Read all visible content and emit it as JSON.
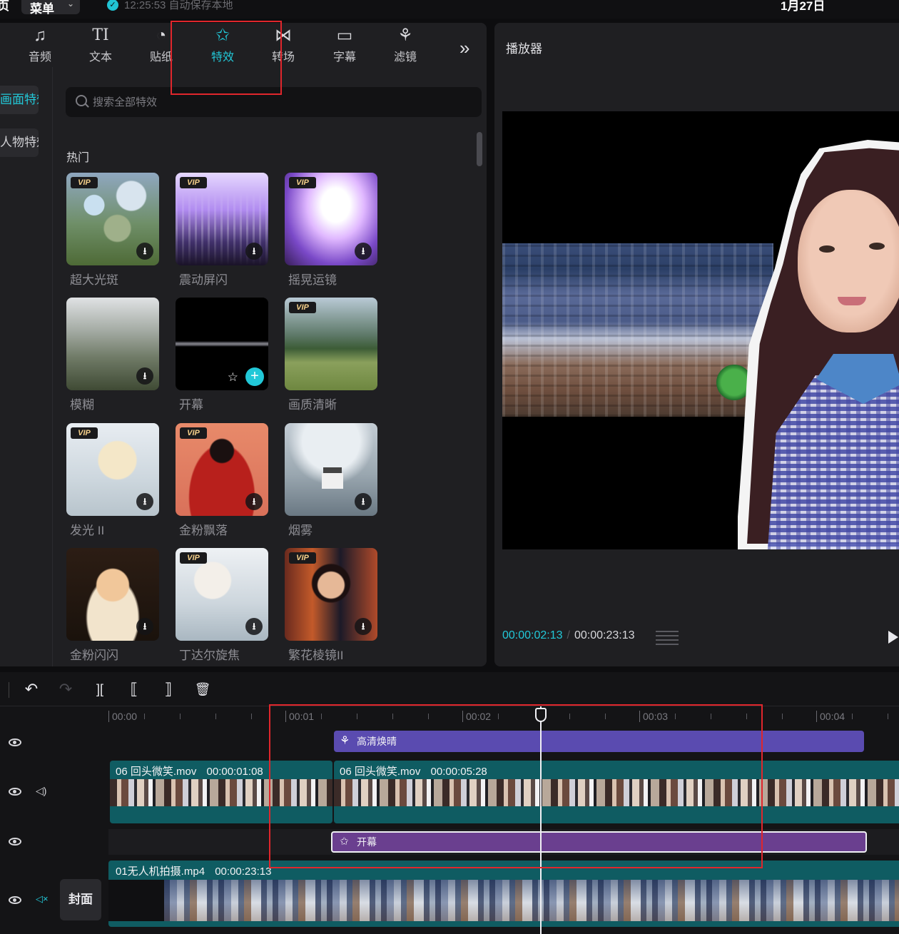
{
  "topbar": {
    "left_cut": "页",
    "menu_label": "菜单",
    "autosave_text": "12:25:53 自动保存本地",
    "date_text": "1月27日"
  },
  "tabs": [
    {
      "label": "音频",
      "icon": "music-note-icon"
    },
    {
      "label": "文本",
      "icon": "text-icon"
    },
    {
      "label": "贴纸",
      "icon": "sticker-icon"
    },
    {
      "label": "特效",
      "icon": "sparkle-star-icon",
      "active": true
    },
    {
      "label": "转场",
      "icon": "bowtie-transition-icon"
    },
    {
      "label": "字幕",
      "icon": "subtitle-icon"
    },
    {
      "label": "滤镜",
      "icon": "filter-circles-icon"
    }
  ],
  "tab_icons": {
    "audio": "♫",
    "text": "TI",
    "sticker": "◔",
    "effect": "✩",
    "transition": "⋈",
    "subtitle": "▭",
    "filter": "⚘",
    "more": "»"
  },
  "categories": [
    {
      "label": "画面特效",
      "active": true
    },
    {
      "label": "人物特效",
      "active": false
    }
  ],
  "search": {
    "placeholder": "搜索全部特效"
  },
  "section_title": "热门",
  "effects": [
    {
      "name": "超大光斑",
      "vip": true,
      "action": "download"
    },
    {
      "name": "震动屏闪",
      "vip": true,
      "action": "download"
    },
    {
      "name": "摇晃运镜",
      "vip": true,
      "action": "download"
    },
    {
      "name": "模糊",
      "vip": false,
      "action": "download"
    },
    {
      "name": "开幕",
      "vip": false,
      "action": "add"
    },
    {
      "name": "画质清晰",
      "vip": true,
      "action": "none"
    },
    {
      "name": "发光 II",
      "vip": true,
      "action": "download"
    },
    {
      "name": "金粉飘落",
      "vip": true,
      "action": "download"
    },
    {
      "name": "烟雾",
      "vip": false,
      "action": "download"
    },
    {
      "name": "金粉闪闪",
      "vip": false,
      "action": "download"
    },
    {
      "name": "丁达尔旋焦",
      "vip": true,
      "action": "download"
    },
    {
      "name": "繁花棱镜II",
      "vip": true,
      "action": "download"
    }
  ],
  "badges": {
    "vip": "VIP",
    "download": "⭳",
    "add": "+",
    "favorite": "☆"
  },
  "player": {
    "title": "播放器",
    "current_time": "00:00:02:13",
    "separator": "/",
    "total_time": "00:00:23:13"
  },
  "timeline": {
    "tool_icons": {
      "undo": "↶",
      "redo": "↷",
      "split": "][",
      "split_left": "⟦",
      "split_right": "⟧",
      "delete": "🗑"
    },
    "ruler_labels": [
      "00:00",
      "00:01",
      "00:02",
      "00:03",
      "00:04"
    ],
    "filter_clip": {
      "label": "高清焕晴",
      "icon": "filter-icon"
    },
    "video_clip_1": {
      "name": "06 回头微笑.mov",
      "duration": "00:00:01:08"
    },
    "video_clip_2": {
      "name": "06 回头微笑.mov",
      "duration": "00:00:05:28"
    },
    "effect_clip": {
      "label": "开幕",
      "icon": "effect-icon"
    },
    "main_clip": {
      "name": "01无人机拍摄.mp4",
      "duration": "00:00:23:13"
    },
    "cover_label": "封面"
  },
  "colors": {
    "accent": "#22c8d8",
    "highlight_box": "#e0262c",
    "filter_track": "#5a4bb0",
    "effect_track": "#6a3f8f",
    "video_track": "#0f5c62"
  }
}
